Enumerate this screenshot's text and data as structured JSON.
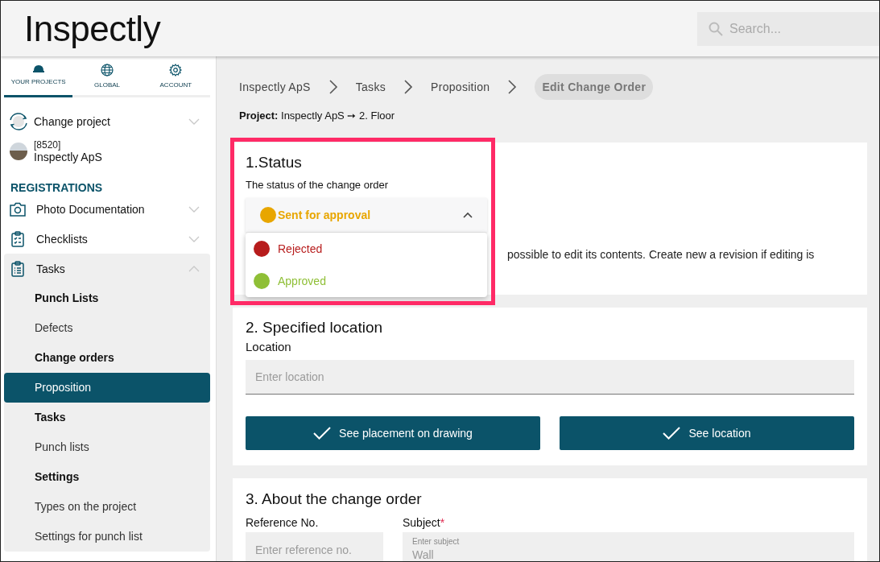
{
  "header": {
    "logo": "Inspectly",
    "search": {
      "placeholder": "Search..."
    }
  },
  "sidebar": {
    "tabs": [
      {
        "label": "YOUR PROJECTS",
        "selected": true
      },
      {
        "label": "GLOBAL",
        "selected": false
      },
      {
        "label": "ACCOUNT",
        "selected": false
      }
    ],
    "change_project": "Change project",
    "project": {
      "number": "[8520]",
      "name": "Inspectly ApS"
    },
    "section_title": "REGISTRATIONS",
    "items": [
      {
        "label": "Photo Documentation",
        "expanded": false
      },
      {
        "label": "Checklists",
        "expanded": false
      },
      {
        "label": "Tasks",
        "expanded": true,
        "children": [
          {
            "label": "Punch Lists",
            "kind": "heading",
            "selected": false
          },
          {
            "label": "Defects",
            "kind": "link",
            "selected": false
          },
          {
            "label": "Change orders",
            "kind": "heading",
            "selected": false
          },
          {
            "label": "Proposition",
            "kind": "link",
            "selected": true
          },
          {
            "label": "Tasks",
            "kind": "heading",
            "selected": false
          },
          {
            "label": "Punch lists",
            "kind": "link",
            "selected": false
          },
          {
            "label": "Settings",
            "kind": "heading",
            "selected": false
          },
          {
            "label": "Types on the project",
            "kind": "link",
            "selected": false
          },
          {
            "label": "Settings for punch list",
            "kind": "link",
            "selected": false
          }
        ]
      }
    ]
  },
  "breadcrumbs": [
    {
      "label": "Inspectly ApS",
      "selected": false
    },
    {
      "label": "Tasks",
      "selected": false
    },
    {
      "label": "Proposition",
      "selected": false
    },
    {
      "label": "Edit Change Order",
      "selected": true
    }
  ],
  "project_line": {
    "label": "Project:",
    "value": "Inspectly ApS ➙ 2. Floor"
  },
  "status": {
    "title": "1.Status",
    "label": "The status of the change order",
    "dropdown": {
      "expanded": true,
      "value": "Sent for approval",
      "color": "#e8a600",
      "options": [
        {
          "label": "Rejected",
          "color": "#b71c1c"
        },
        {
          "label": "Approved",
          "color": "#8fbf36"
        }
      ]
    },
    "note": "possible to edit its contents. Create new a revision if editing is"
  },
  "location": {
    "title": "2. Specified location",
    "label": "Location",
    "placeholder": "Enter location",
    "buttons": [
      "See placement on drawing",
      "See location"
    ]
  },
  "about": {
    "title": "3. About the change order",
    "reference": {
      "label": "Reference No.",
      "placeholder": "Enter reference no."
    },
    "subject": {
      "label": "Subject",
      "required_mark": "*",
      "floating_label": "Enter subject",
      "value": "Wall"
    }
  }
}
